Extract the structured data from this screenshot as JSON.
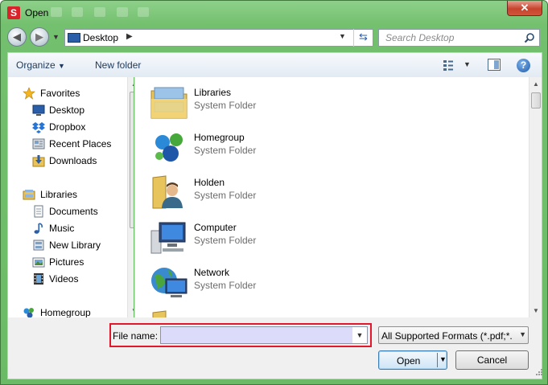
{
  "window": {
    "title": "Open",
    "app_icon_letter": "S",
    "close_glyph": "✕"
  },
  "address": {
    "location": "Desktop",
    "search_placeholder": "Search Desktop"
  },
  "toolbar": {
    "organize_label": "Organize",
    "new_folder_label": "New folder"
  },
  "sidebar": {
    "items": [
      {
        "label": "Favorites",
        "icon": "star-icon"
      },
      {
        "label": "Desktop",
        "icon": "desktop-icon"
      },
      {
        "label": "Dropbox",
        "icon": "dropbox-icon"
      },
      {
        "label": "Recent Places",
        "icon": "recent-places-icon"
      },
      {
        "label": "Downloads",
        "icon": "downloads-icon"
      },
      {
        "label": "Libraries",
        "icon": "libraries-icon"
      },
      {
        "label": "Documents",
        "icon": "documents-icon"
      },
      {
        "label": "Music",
        "icon": "music-icon"
      },
      {
        "label": "New Library",
        "icon": "library-icon"
      },
      {
        "label": "Pictures",
        "icon": "pictures-icon"
      },
      {
        "label": "Videos",
        "icon": "videos-icon"
      },
      {
        "label": "Homegroup",
        "icon": "homegroup-icon"
      }
    ]
  },
  "files": [
    {
      "name": "Libraries",
      "type": "System Folder",
      "icon": "libraries-folder-icon"
    },
    {
      "name": "Homegroup",
      "type": "System Folder",
      "icon": "homegroup-icon"
    },
    {
      "name": "Holden",
      "type": "System Folder",
      "icon": "user-folder-icon"
    },
    {
      "name": "Computer",
      "type": "System Folder",
      "icon": "computer-icon"
    },
    {
      "name": "Network",
      "type": "System Folder",
      "icon": "network-icon"
    }
  ],
  "bottom": {
    "file_name_label": "File name:",
    "file_name_value": "",
    "filter_value": "All Supported Formats (*.pdf;*.o",
    "open_label": "Open",
    "cancel_label": "Cancel"
  },
  "colors": {
    "frame": "#6bbb66",
    "highlight": "#e3172b",
    "input_fill": "#dcdcfa"
  }
}
